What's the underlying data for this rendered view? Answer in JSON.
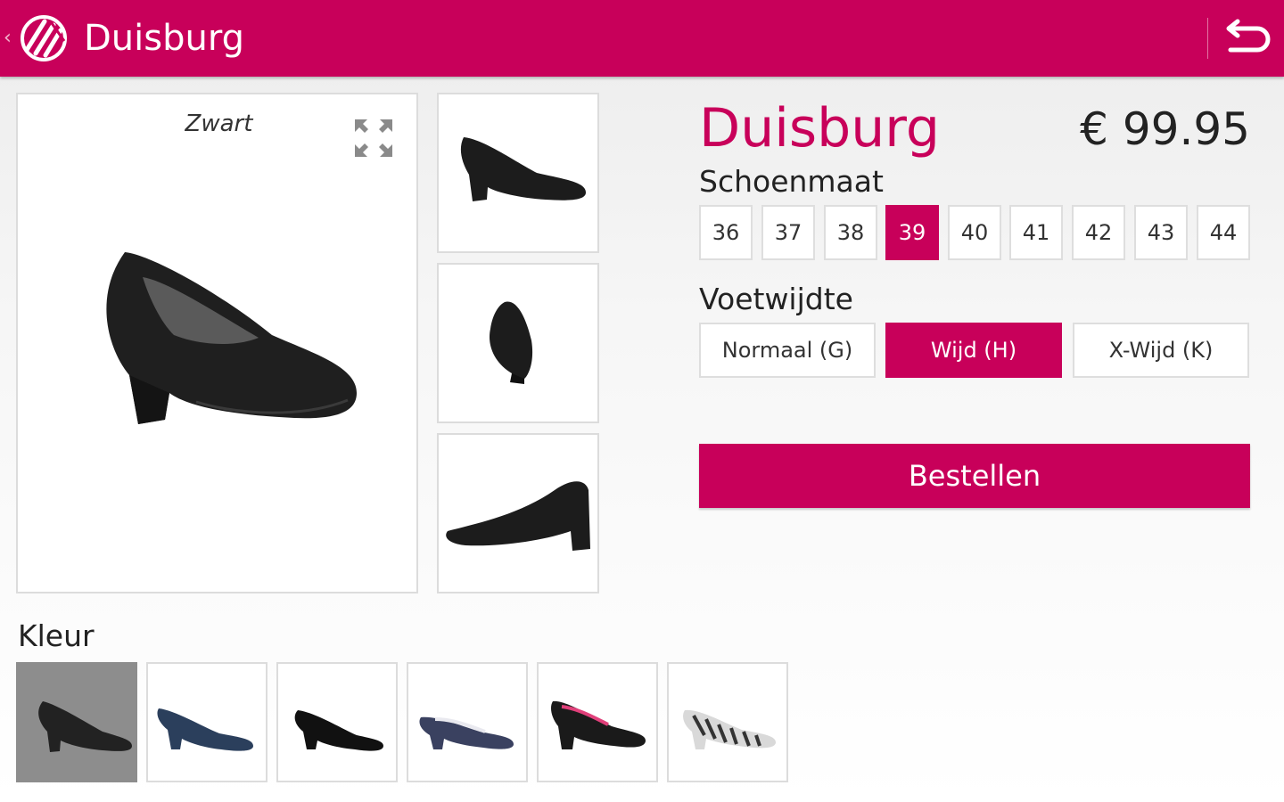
{
  "header": {
    "title": "Duisburg"
  },
  "product": {
    "name": "Duisburg",
    "price": "€ 99.95",
    "color_caption": "Zwart"
  },
  "sizes": {
    "label": "Schoenmaat",
    "options": [
      "36",
      "37",
      "38",
      "39",
      "40",
      "41",
      "42",
      "43",
      "44"
    ],
    "selected": "39"
  },
  "widths": {
    "label": "Voetwijdte",
    "options": [
      "Normaal (G)",
      "Wijd (H)",
      "X-Wijd (K)"
    ],
    "selected": "Wijd (H)"
  },
  "order_button": {
    "label": "Bestellen"
  },
  "colors": {
    "label": "Kleur",
    "swatch_count": 6,
    "selected_index": 0
  },
  "theme": {
    "accent": "#c8005a"
  },
  "icons": [
    "back-chevron-icon",
    "brand-logo-icon",
    "undo-icon",
    "expand-icon"
  ]
}
